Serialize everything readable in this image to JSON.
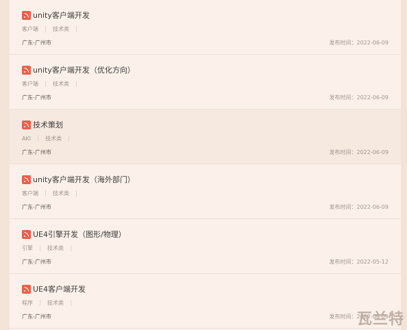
{
  "jobs": [
    {
      "title": "unity客户端开发",
      "tags": [
        "客户端",
        "技术类"
      ],
      "location": "广东-广州市",
      "date": "发布时间：2022-06-09"
    },
    {
      "title": "unity客户端开发（优化方向）",
      "tags": [
        "客户端",
        "技术类"
      ],
      "location": "广东-广州市",
      "date": "发布时间：2022-06-09"
    },
    {
      "title": "技术策划",
      "tags": [
        "AKI",
        "技术类"
      ],
      "location": "广东-广州市",
      "date": "发布时间：2022-06-09"
    },
    {
      "title": "unity客户端开发（海外部门）",
      "tags": [
        "客户端",
        "技术类"
      ],
      "location": "广东-广州市",
      "date": "发布时间：2022-06-09"
    },
    {
      "title": "UE4引擎开发（图形/物理）",
      "tags": [
        "引擎",
        "技术类"
      ],
      "location": "广东-广州市",
      "date": "发布时间：2022-05-12"
    },
    {
      "title": "UE4客户端开发",
      "tags": [
        "程序",
        "技术类"
      ],
      "location": "广东-广州市",
      "date": "发布时间：2022-06-09"
    }
  ],
  "watermark": "瓦兰特",
  "colors": {
    "accent": "#e8614a",
    "background": "#fbf1ea",
    "highlight": "#f6e9e0"
  }
}
